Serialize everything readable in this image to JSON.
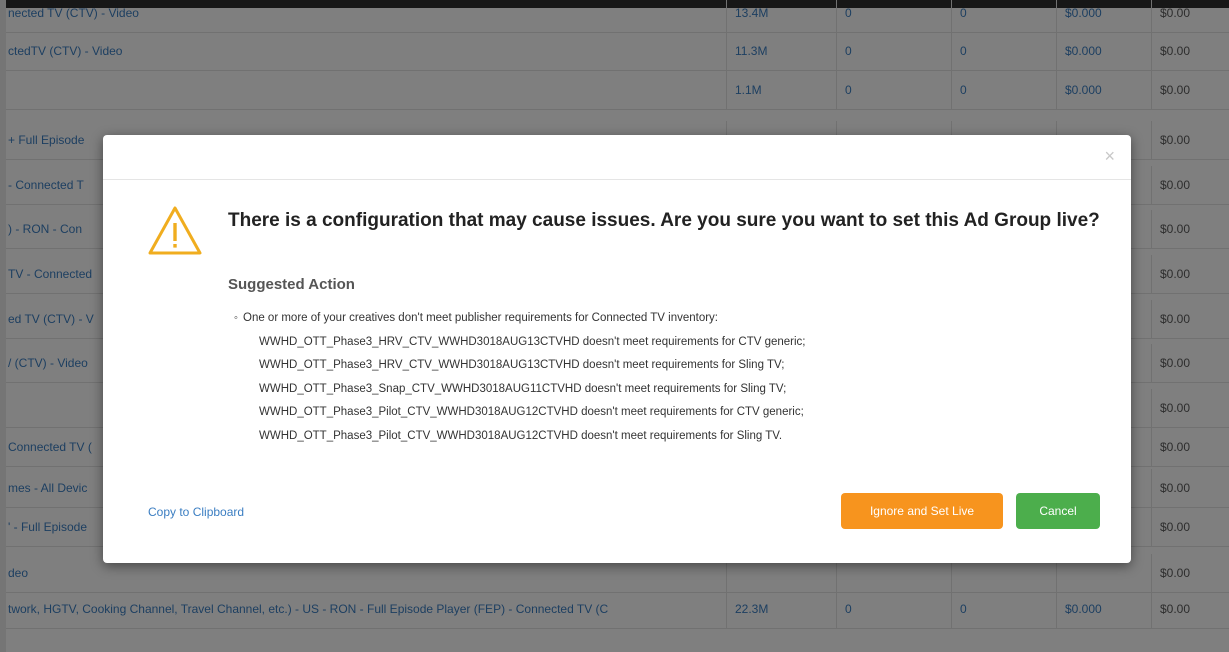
{
  "background_table": {
    "rows": [
      {
        "name": "nected TV (CTV) - Video",
        "impressions": "13.4M",
        "col1": "0",
        "col2": "0",
        "cost": "$0.000",
        "total": "$0.00"
      },
      {
        "name": "ctedTV (CTV) - Video",
        "impressions": "11.3M",
        "col1": "0",
        "col2": "0",
        "cost": "$0.000",
        "total": "$0.00"
      },
      {
        "name": "",
        "impressions": "1.1M",
        "col1": "0",
        "col2": "0",
        "cost": "$0.000",
        "total": "$0.00"
      },
      {
        "name": "+ Full Episode",
        "impressions": "",
        "col1": "",
        "col2": "",
        "cost": "",
        "total": "$0.00"
      },
      {
        "name": "- Connected T",
        "impressions": "",
        "col1": "",
        "col2": "",
        "cost": "",
        "total": "$0.00"
      },
      {
        "name": ") - RON - Con",
        "impressions": "",
        "col1": "",
        "col2": "",
        "cost": "",
        "total": "$0.00"
      },
      {
        "name": "TV - Connected",
        "impressions": "",
        "col1": "",
        "col2": "",
        "cost": "",
        "total": "$0.00"
      },
      {
        "name": "ed TV (CTV) - V",
        "impressions": "",
        "col1": "",
        "col2": "",
        "cost": "",
        "total": "$0.00"
      },
      {
        "name": "/ (CTV) - Video",
        "impressions": "",
        "col1": "",
        "col2": "",
        "cost": "",
        "total": "$0.00"
      },
      {
        "name": "",
        "impressions": "",
        "col1": "",
        "col2": "",
        "cost": "",
        "total": "$0.00"
      },
      {
        "name": "Connected TV (",
        "impressions": "",
        "col1": "",
        "col2": "",
        "cost": "",
        "total": "$0.00"
      },
      {
        "name": "mes - All Devic",
        "impressions": "",
        "col1": "",
        "col2": "",
        "cost": "",
        "total": "$0.00"
      },
      {
        "name": "' - Full Episode",
        "impressions": "",
        "col1": "",
        "col2": "",
        "cost": "",
        "total": "$0.00"
      },
      {
        "name": "deo",
        "impressions": "",
        "col1": "",
        "col2": "",
        "cost": "",
        "total": "$0.00"
      },
      {
        "name": "twork, HGTV, Cooking Channel, Travel Channel, etc.) - US - RON - Full Episode Player (FEP) - Connected TV (C",
        "impressions": "22.3M",
        "col1": "0",
        "col2": "0",
        "cost": "$0.000",
        "total": "$0.00"
      }
    ]
  },
  "modal": {
    "close_label": "×",
    "warning_icon": "warning-triangle-icon",
    "warning_color": "#f0ad1f",
    "title": "There is a configuration that may cause issues. Are you sure you want to set this Ad Group live?",
    "suggested_heading": "Suggested Action",
    "bullet_glyph": "◦",
    "issue_lines": [
      "One or more of your creatives don't meet publisher requirements for Connected TV inventory:",
      "WWHD_OTT_Phase3_HRV_CTV_WWHD3018AUG13CTVHD doesn't meet requirements for CTV generic;",
      "WWHD_OTT_Phase3_HRV_CTV_WWHD3018AUG13CTVHD doesn't meet requirements for Sling TV;",
      "WWHD_OTT_Phase3_Snap_CTV_WWHD3018AUG11CTVHD doesn't meet requirements for Sling TV;",
      "WWHD_OTT_Phase3_Pilot_CTV_WWHD3018AUG12CTVHD doesn't meet requirements for CTV generic;",
      "WWHD_OTT_Phase3_Pilot_CTV_WWHD3018AUG12CTVHD doesn't meet requirements for Sling TV."
    ],
    "copy_link": "Copy to Clipboard",
    "ignore_button": "Ignore and Set Live",
    "cancel_button": "Cancel",
    "ignore_color": "#f7941e",
    "cancel_color": "#4cae4c"
  }
}
